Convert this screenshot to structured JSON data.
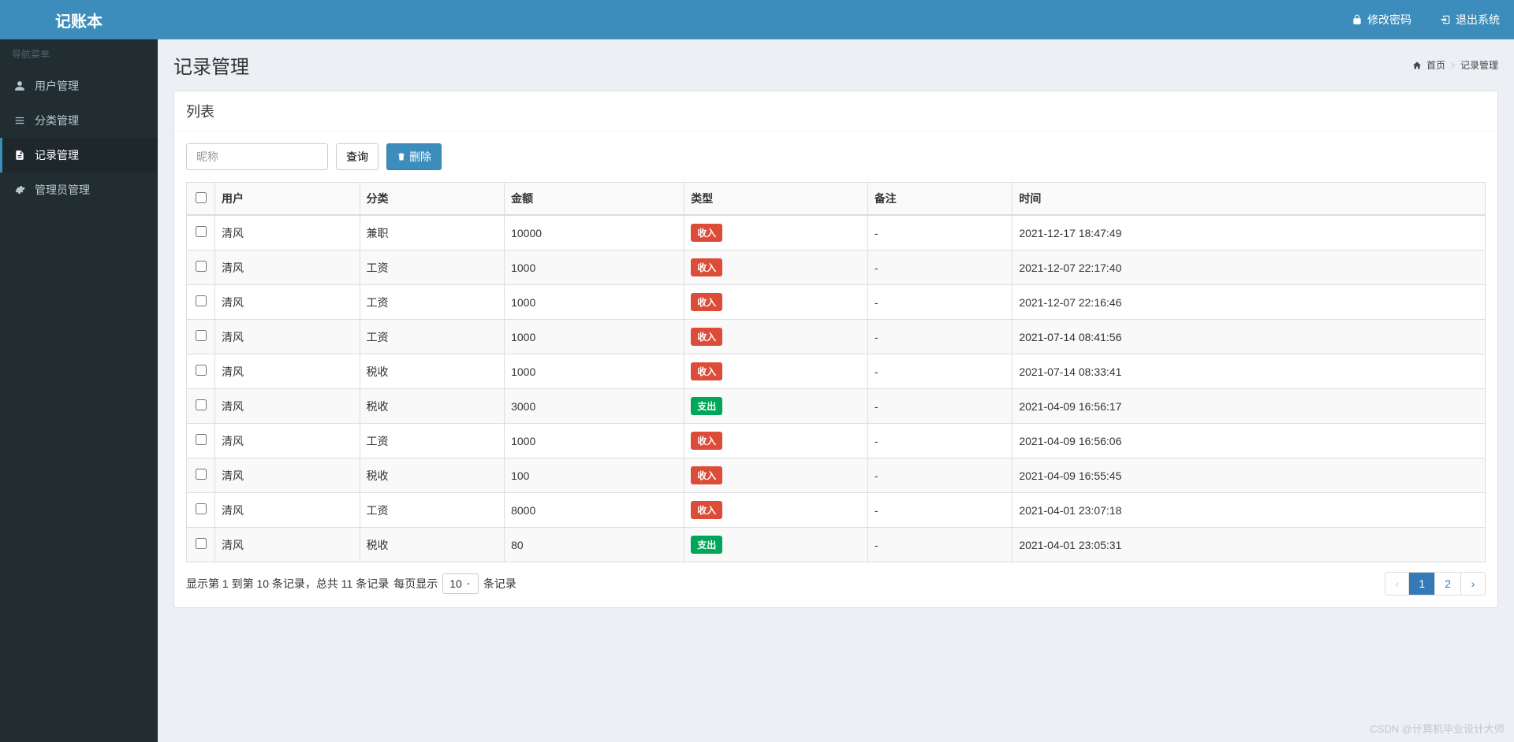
{
  "app": {
    "title": "记账本"
  },
  "topbar": {
    "change_password": "修改密码",
    "logout": "退出系统"
  },
  "sidebar": {
    "header": "导航菜单",
    "items": [
      {
        "label": "用户管理"
      },
      {
        "label": "分类管理"
      },
      {
        "label": "记录管理"
      },
      {
        "label": "管理员管理"
      }
    ]
  },
  "page": {
    "title": "记录管理",
    "breadcrumb_home": "首页",
    "breadcrumb_current": "记录管理"
  },
  "panel": {
    "list_title": "列表",
    "search_placeholder": "昵称",
    "query_btn": "查询",
    "delete_btn": "删除"
  },
  "table": {
    "columns": {
      "user": "用户",
      "category": "分类",
      "amount": "金额",
      "type": "类型",
      "remark": "备注",
      "time": "时间"
    },
    "type_labels": {
      "income": "收入",
      "expense": "支出"
    },
    "rows": [
      {
        "user": "清风",
        "category": "兼职",
        "amount": "10000",
        "type": "income",
        "remark": "-",
        "time": "2021-12-17 18:47:49"
      },
      {
        "user": "清风",
        "category": "工资",
        "amount": "1000",
        "type": "income",
        "remark": "-",
        "time": "2021-12-07 22:17:40"
      },
      {
        "user": "清风",
        "category": "工资",
        "amount": "1000",
        "type": "income",
        "remark": "-",
        "time": "2021-12-07 22:16:46"
      },
      {
        "user": "清风",
        "category": "工资",
        "amount": "1000",
        "type": "income",
        "remark": "-",
        "time": "2021-07-14 08:41:56"
      },
      {
        "user": "清风",
        "category": "税收",
        "amount": "1000",
        "type": "income",
        "remark": "-",
        "time": "2021-07-14 08:33:41"
      },
      {
        "user": "清风",
        "category": "税收",
        "amount": "3000",
        "type": "expense",
        "remark": "-",
        "time": "2021-04-09 16:56:17"
      },
      {
        "user": "清风",
        "category": "工资",
        "amount": "1000",
        "type": "income",
        "remark": "-",
        "time": "2021-04-09 16:56:06"
      },
      {
        "user": "清风",
        "category": "税收",
        "amount": "100",
        "type": "income",
        "remark": "-",
        "time": "2021-04-09 16:55:45"
      },
      {
        "user": "清风",
        "category": "工资",
        "amount": "8000",
        "type": "income",
        "remark": "-",
        "time": "2021-04-01 23:07:18"
      },
      {
        "user": "清风",
        "category": "税收",
        "amount": "80",
        "type": "expense",
        "remark": "-",
        "time": "2021-04-01 23:05:31"
      }
    ]
  },
  "pagination": {
    "info_prefix": "显示第 1 到第 10 条记录，总共 11 条记录",
    "per_page_prefix": "每页显示",
    "per_page_suffix": "条记录",
    "page_size": "10",
    "prev": "‹",
    "next": "›",
    "pages": [
      "1",
      "2"
    ],
    "current": "1"
  },
  "watermark": "CSDN @计算机毕业设计大师"
}
